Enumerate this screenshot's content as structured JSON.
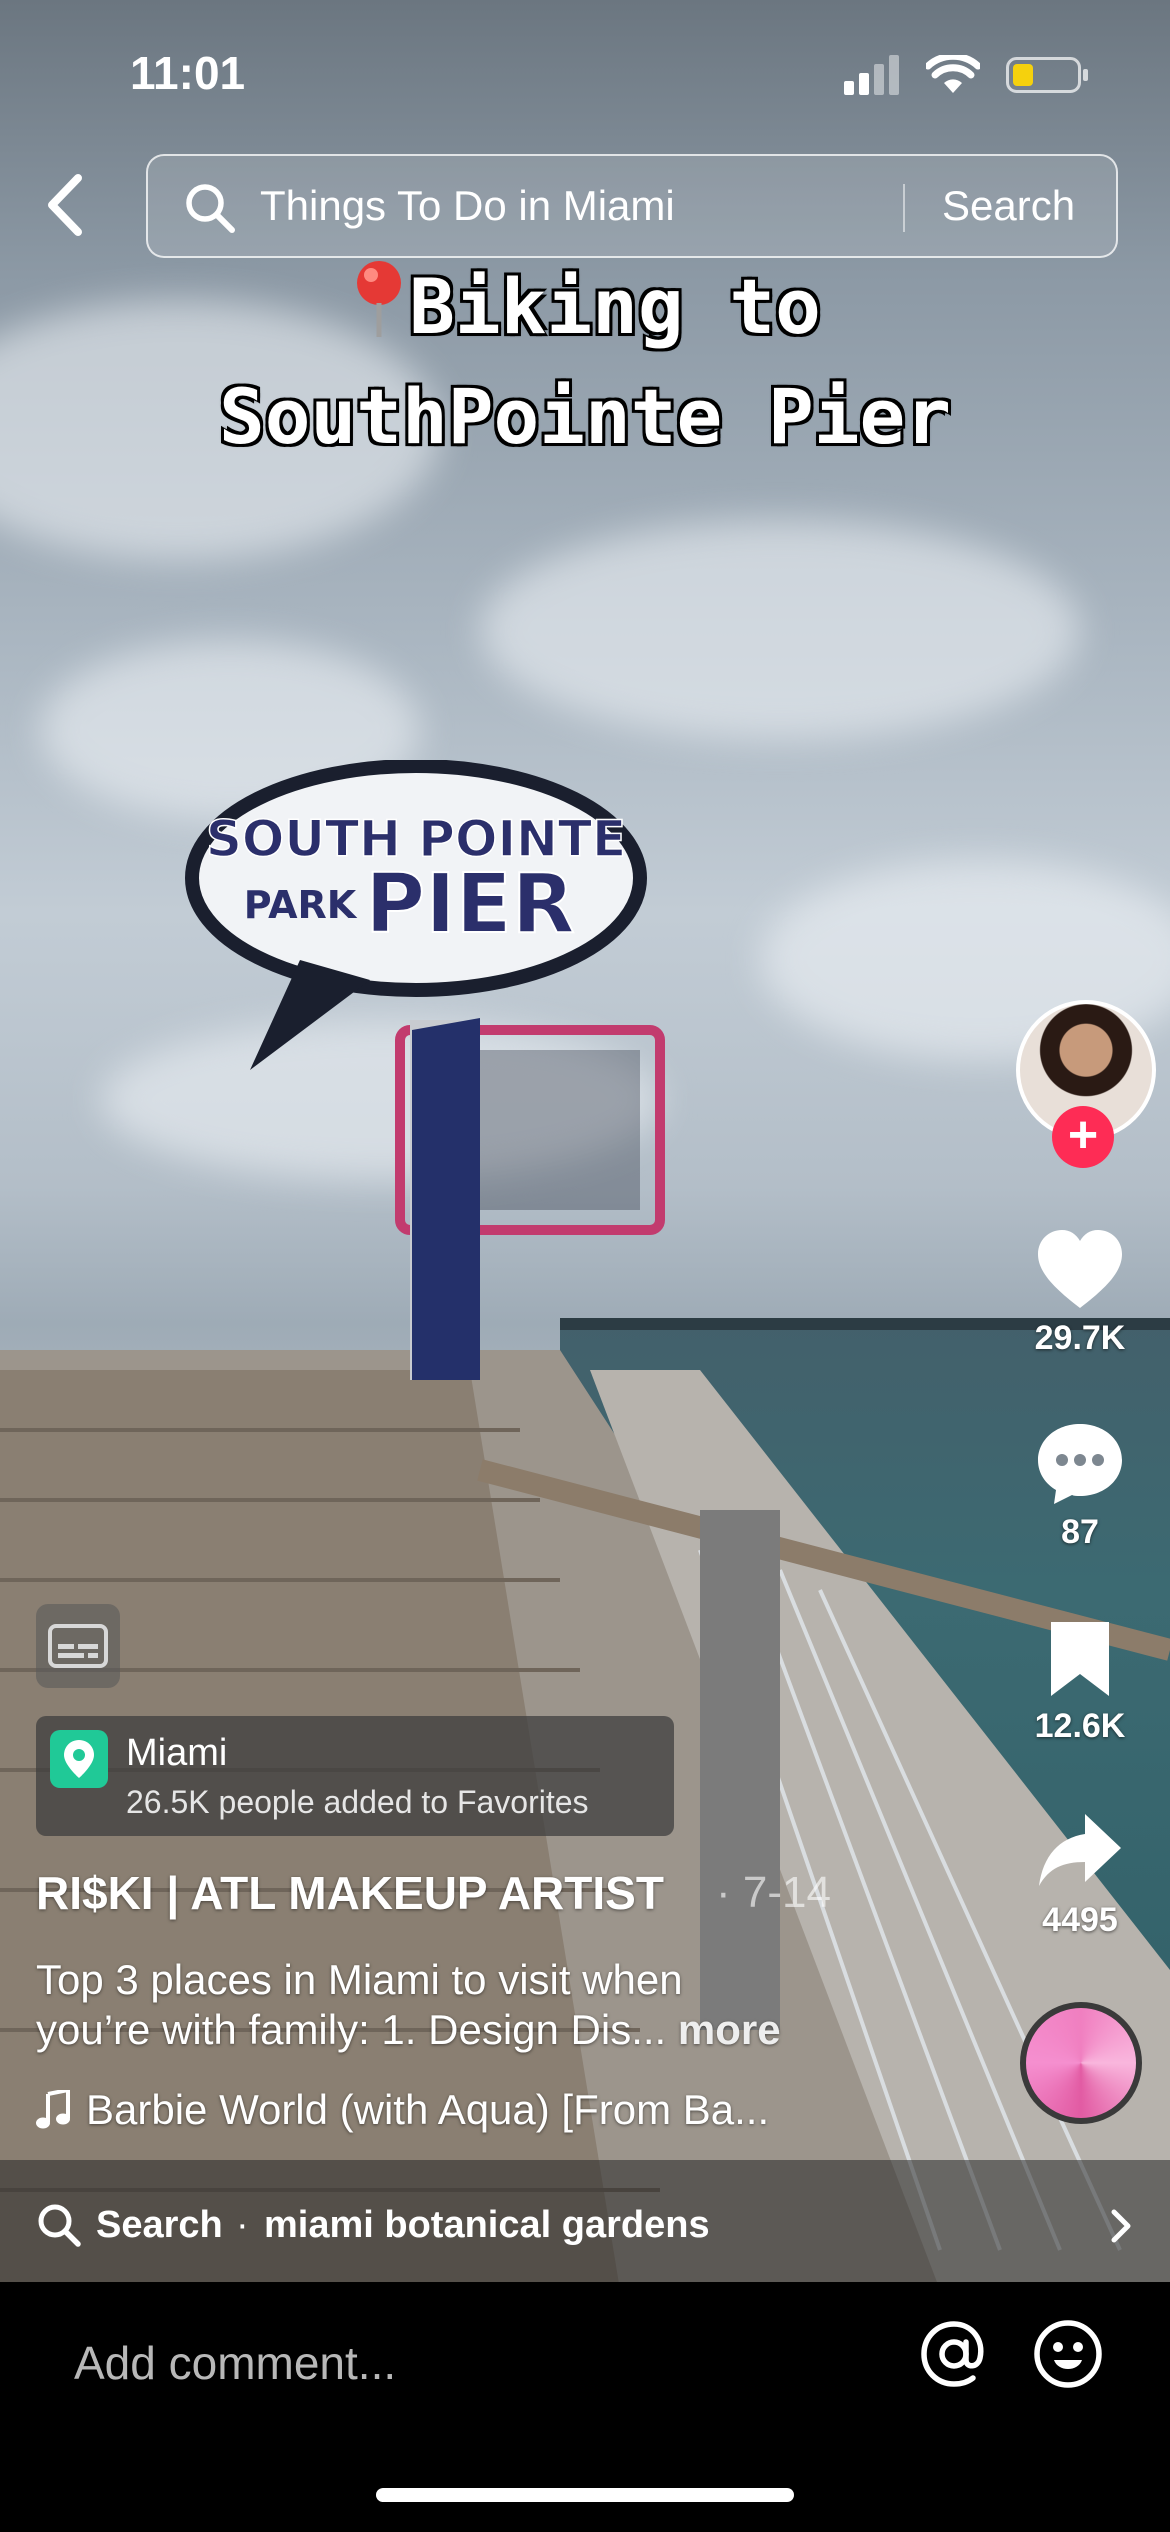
{
  "status_bar": {
    "time": "11:01",
    "battery_color": "#f5d10d"
  },
  "top_bar": {
    "back_icon": "chevron-left-icon",
    "search_query": "Things To Do in Miami",
    "search_button": "Search"
  },
  "video": {
    "overlay_line1": "Biking to",
    "overlay_line2": "SouthPointe Pier",
    "sign_text_1": "SOUTH POINTE",
    "sign_text_2": "PARK",
    "sign_text_3": "PIER"
  },
  "actions": {
    "likes": "29.7K",
    "comments": "87",
    "saves": "12.6K",
    "shares": "4495",
    "follow_color": "#fe2c55"
  },
  "place": {
    "name": "Miami",
    "favorites": "26.5K people added to Favorites",
    "pin_color": "#20c997"
  },
  "post": {
    "author": "RI$KI | ATL MAKEUP ARTIST",
    "date": "· 7-14",
    "description_line1": "Top 3 places in Miami to visit when",
    "description_line2": "you’re with family:  1. Design Dis...",
    "more": "more",
    "music": "Barbie World (with Aqua) [From Ba..."
  },
  "related_search": {
    "label": "Search",
    "separator": "·",
    "term": "miami botanical gardens"
  },
  "comment_bar": {
    "placeholder": "Add comment..."
  }
}
